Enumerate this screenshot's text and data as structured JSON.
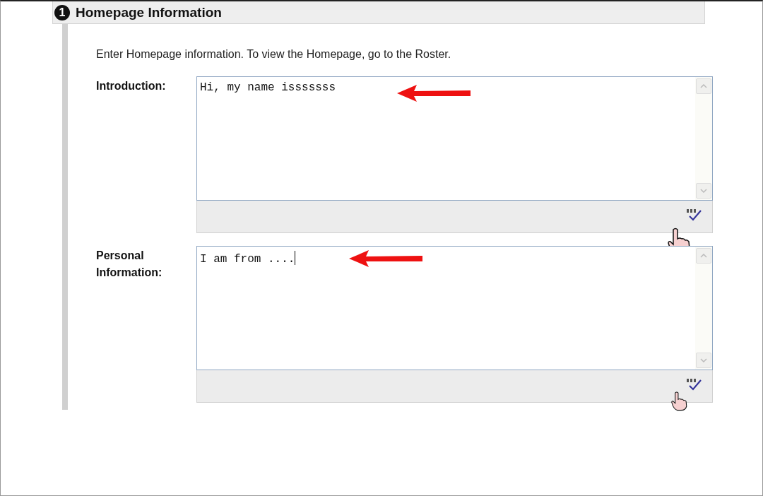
{
  "section": {
    "number": "1",
    "title": "Homepage Information"
  },
  "instructions": "Enter Homepage information. To view the Homepage, go to the Roster.",
  "fields": [
    {
      "label": "Introduction:",
      "value": "Hi, my name isssssss",
      "focused": false
    },
    {
      "label": "Personal Information:",
      "value": "I am from ....",
      "focused": true
    }
  ]
}
